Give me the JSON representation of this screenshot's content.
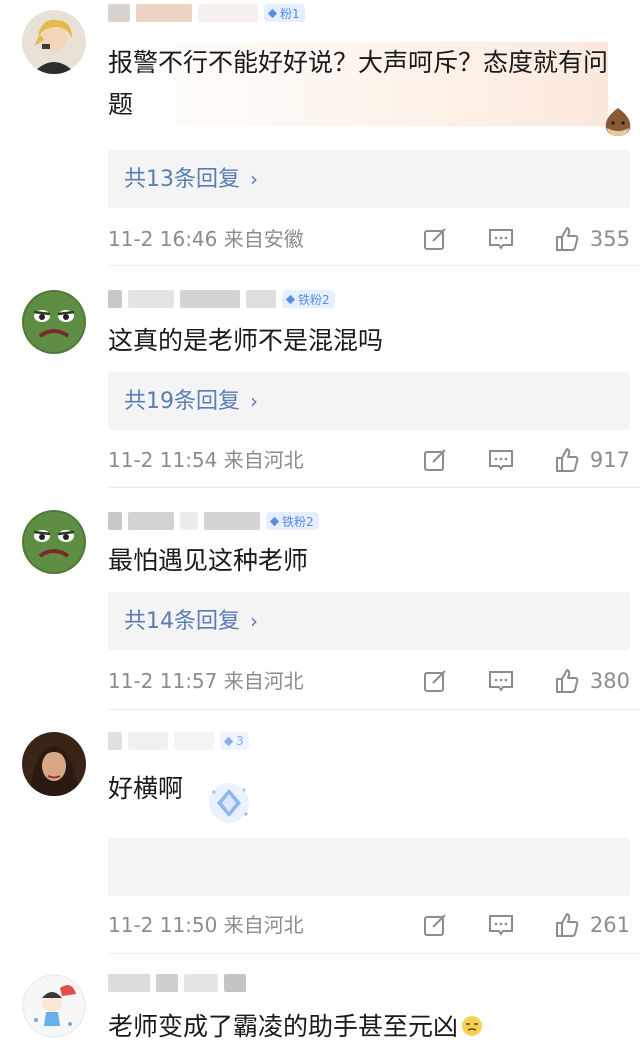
{
  "comments": [
    {
      "badge": "粉1",
      "text": "报警不行不能好好说？大声呵斥？态度就有问题",
      "reply_label": "共13条回复",
      "time": "11-2 16:46",
      "location": "来自安徽",
      "likes": "355"
    },
    {
      "badge": "铁粉2",
      "text": "这真的是老师不是混混吗",
      "reply_label": "共19条回复",
      "time": "11-2 11:54",
      "location": "来自河北",
      "likes": "917"
    },
    {
      "badge": "铁粉2",
      "text": "最怕遇见这种老师",
      "reply_label": "共14条回复",
      "time": "11-2 11:57",
      "location": "来自河北",
      "likes": "380"
    },
    {
      "badge": "3",
      "text": "好横啊",
      "reply_label": "",
      "time": "11-2 11:50",
      "location": "来自河北",
      "likes": "261"
    },
    {
      "text": "老师变成了霸凌的助手甚至元凶"
    }
  ],
  "icons": {
    "repost": "share-edit-icon",
    "comment": "comment-icon",
    "like": "thumbs-up-icon",
    "chevron": "chevron-right-icon"
  },
  "colors": {
    "link": "#5a7db5",
    "meta": "#8c8c8c",
    "badge_bg": "#e6efff",
    "badge_text": "#5a8be8",
    "reply_bg": "#f4f4f4"
  }
}
